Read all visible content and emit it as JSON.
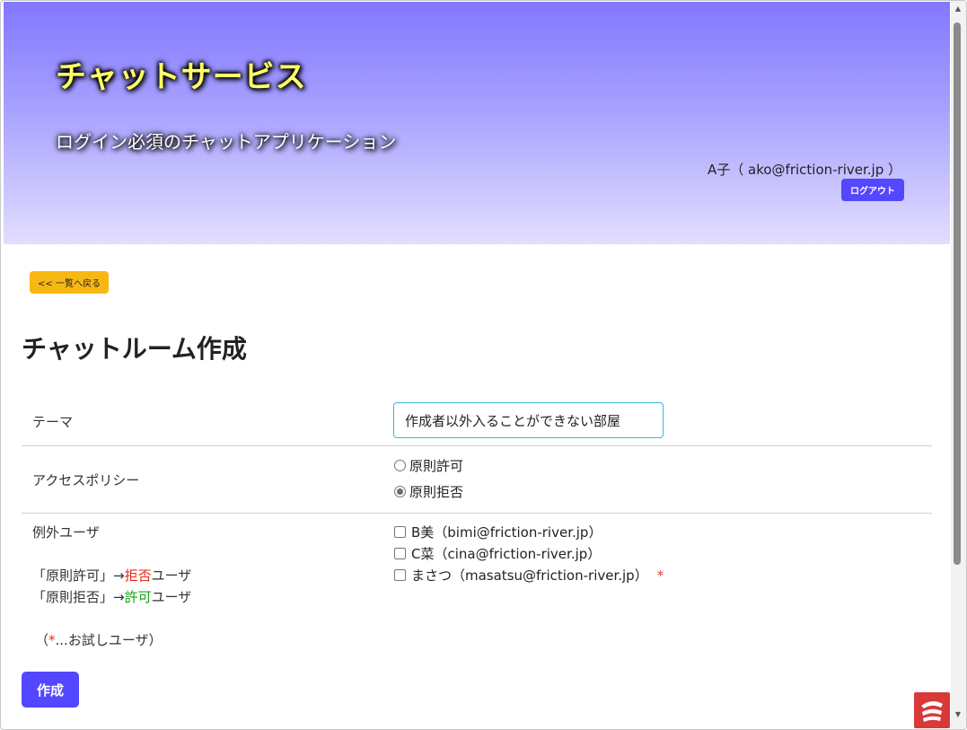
{
  "header": {
    "title": "チャットサービス",
    "subtitle": "ログイン必須のチャットアプリケーション",
    "user_info": "A子（ ako@friction-river.jp ）",
    "logout_label": "ログアウト"
  },
  "nav": {
    "back_label": "<< 一覧へ戻る"
  },
  "page": {
    "title": "チャットルーム作成"
  },
  "form": {
    "theme": {
      "label": "テーマ",
      "value": "作成者以外入ることができない部屋"
    },
    "access_policy": {
      "label": "アクセスポリシー",
      "options": [
        {
          "label": "原則許可",
          "checked": false
        },
        {
          "label": "原則拒否",
          "checked": true
        }
      ]
    },
    "exception_users": {
      "label": "例外ユーザ",
      "note_allow_prefix": "「原則許可」→",
      "note_allow_word": "拒否",
      "note_allow_suffix": "ユーザ",
      "note_deny_prefix": "「原則拒否」→",
      "note_deny_word": "許可",
      "note_deny_suffix": "ユーザ",
      "trial_note_open": "（",
      "trial_note_star": "*",
      "trial_note_rest": "...お試しユーザ）",
      "users": [
        {
          "label": "B美（bimi@friction-river.jp）",
          "checked": false,
          "trial": false
        },
        {
          "label": "C菜（cina@friction-river.jp）",
          "checked": false,
          "trial": false
        },
        {
          "label": "まさつ（masatsu@friction-river.jp）",
          "checked": false,
          "trial": true
        }
      ],
      "trial_marker": "*"
    },
    "submit_label": "作成"
  },
  "colors": {
    "header_top": "#8277ff",
    "header_bottom": "#e2defe",
    "primary_button": "#5347ff",
    "back_button": "#f8b813",
    "title_yellow": "#ffff66",
    "deny_red": "#e8261b",
    "allow_green": "#19a319"
  }
}
